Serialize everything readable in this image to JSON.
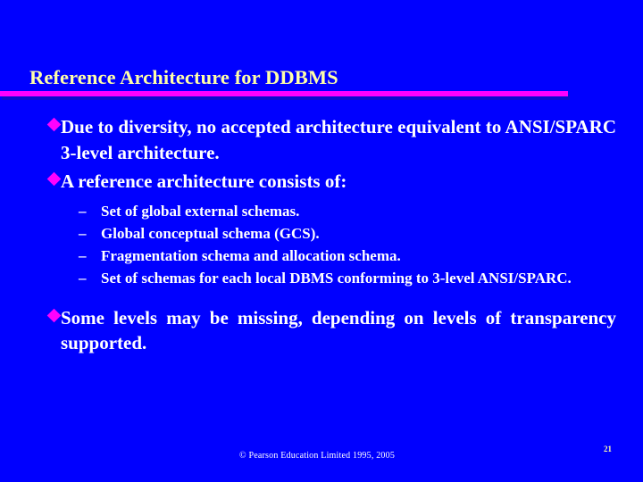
{
  "slide": {
    "background_color": "#0000ff",
    "title": "Reference Architecture for DDBMS",
    "title_color": "#ffffa8",
    "rule_color": "#ff00ff",
    "bullet_marker_color": "#ff00ff",
    "body_text_color": "#ffffff"
  },
  "bullets": [
    {
      "marker": "diamond-bullet",
      "text": "Due to diversity, no accepted architecture equivalent to ANSI/SPARC 3-level architecture."
    },
    {
      "marker": "diamond-bullet",
      "text": "A reference architecture consists of:"
    },
    {
      "marker": "diamond-bullet",
      "text": "Some levels may be missing, depending on levels of transparency supported."
    }
  ],
  "sub_bullets": [
    {
      "marker": "–",
      "text": "Set of global external schemas."
    },
    {
      "marker": "–",
      "text": "Global conceptual schema (GCS)."
    },
    {
      "marker": "–",
      "text": "Fragmentation schema and allocation schema."
    },
    {
      "marker": "–",
      "text": "Set of schemas for each local DBMS conforming to 3-level ANSI/SPARC."
    }
  ],
  "footer": {
    "copyright": "© Pearson Education Limited 1995, 2005",
    "page_number": "21"
  }
}
